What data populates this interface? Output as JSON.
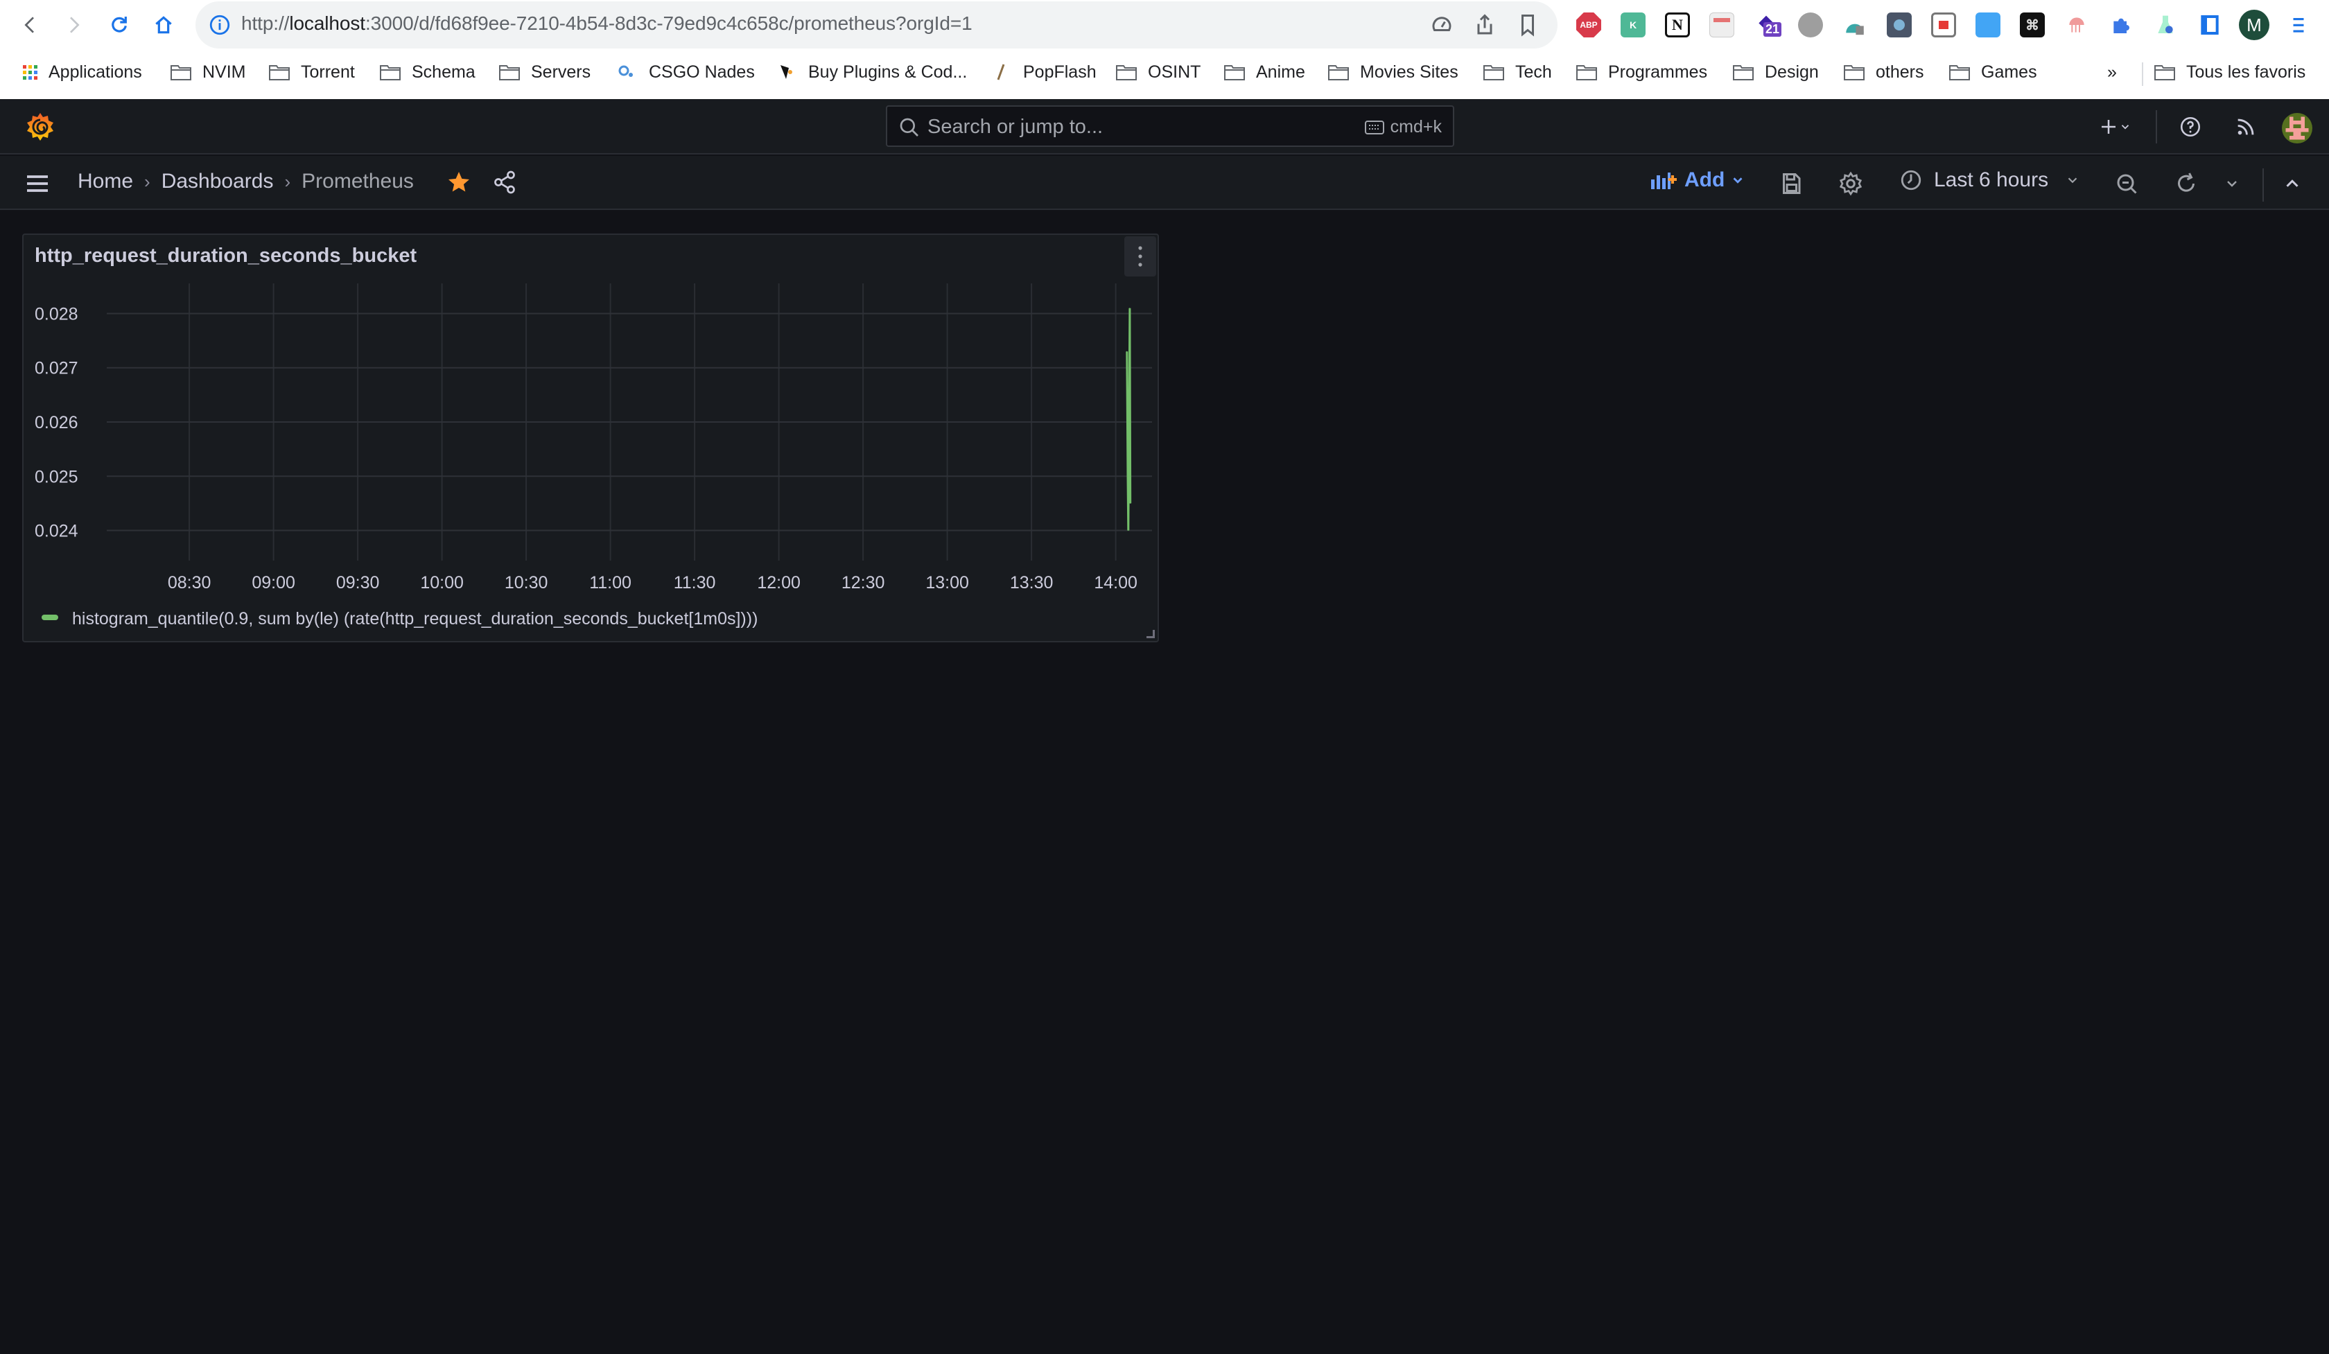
{
  "browser": {
    "url_prefix": "http://",
    "url_host": "localhost",
    "url_rest": ":3000/d/fd68f9ee-7210-4b54-8d3c-79ed9c4c658c/prometheus?orgId=1",
    "extension_badge": "21",
    "profile_initial": "M",
    "bookmarks": [
      {
        "label": "Applications",
        "icon": "apps-grid-icon"
      },
      {
        "label": "NVIM",
        "icon": "folder-icon"
      },
      {
        "label": "Torrent",
        "icon": "folder-icon"
      },
      {
        "label": "Schema",
        "icon": "folder-icon"
      },
      {
        "label": "Servers",
        "icon": "folder-icon"
      },
      {
        "label": "CSGO Nades",
        "icon": "csgo-icon"
      },
      {
        "label": "Buy Plugins & Cod...",
        "icon": "site-icon"
      },
      {
        "label": "PopFlash",
        "icon": "popflash-icon"
      },
      {
        "label": "OSINT",
        "icon": "folder-icon"
      },
      {
        "label": "Anime",
        "icon": "folder-icon"
      },
      {
        "label": "Movies Sites",
        "icon": "folder-icon"
      },
      {
        "label": "Tech",
        "icon": "folder-icon"
      },
      {
        "label": "Programmes",
        "icon": "folder-icon"
      },
      {
        "label": "Design",
        "icon": "folder-icon"
      },
      {
        "label": "others",
        "icon": "folder-icon"
      },
      {
        "label": "Games",
        "icon": "folder-icon"
      }
    ],
    "overflow_label": "»",
    "all_bookmarks_label": "Tous les favoris"
  },
  "grafana": {
    "search_placeholder": "Search or jump to...",
    "search_shortcut": "cmd+k",
    "breadcrumb": [
      "Home",
      "Dashboards",
      "Prometheus"
    ],
    "add_label": "Add",
    "time_range": "Last 6 hours"
  },
  "panel": {
    "title": "http_request_duration_seconds_bucket"
  },
  "colors": {
    "series": "#73bf69",
    "accent_blue": "#6e9fff",
    "star": "#ff9830"
  },
  "chart_data": {
    "type": "line",
    "title": "http_request_duration_seconds_bucket",
    "xlabel": "",
    "ylabel": "",
    "x_ticks": [
      "08:30",
      "09:00",
      "09:30",
      "10:00",
      "10:30",
      "11:00",
      "11:30",
      "12:00",
      "12:30",
      "13:00",
      "13:30",
      "14:00"
    ],
    "y_ticks": [
      0.024,
      0.025,
      0.026,
      0.027,
      0.028
    ],
    "ylim": [
      0.0237,
      0.0283
    ],
    "xlim_minutes_from_0830": [
      -22,
      338
    ],
    "grid": true,
    "legend_position": "bottom-left",
    "series": [
      {
        "name": "histogram_quantile(0.9, sum by(le) (rate(http_request_duration_seconds_bucket[1m0s])))",
        "color": "#73bf69",
        "points": [
          {
            "t_minutes_from_0830": 334.0,
            "value": 0.0273
          },
          {
            "t_minutes_from_0830": 334.3,
            "value": 0.025
          },
          {
            "t_minutes_from_0830": 334.5,
            "value": 0.024
          },
          {
            "t_minutes_from_0830": 334.8,
            "value": 0.0262
          },
          {
            "t_minutes_from_0830": 335.0,
            "value": 0.0281
          },
          {
            "t_minutes_from_0830": 335.2,
            "value": 0.0245
          }
        ]
      }
    ]
  }
}
